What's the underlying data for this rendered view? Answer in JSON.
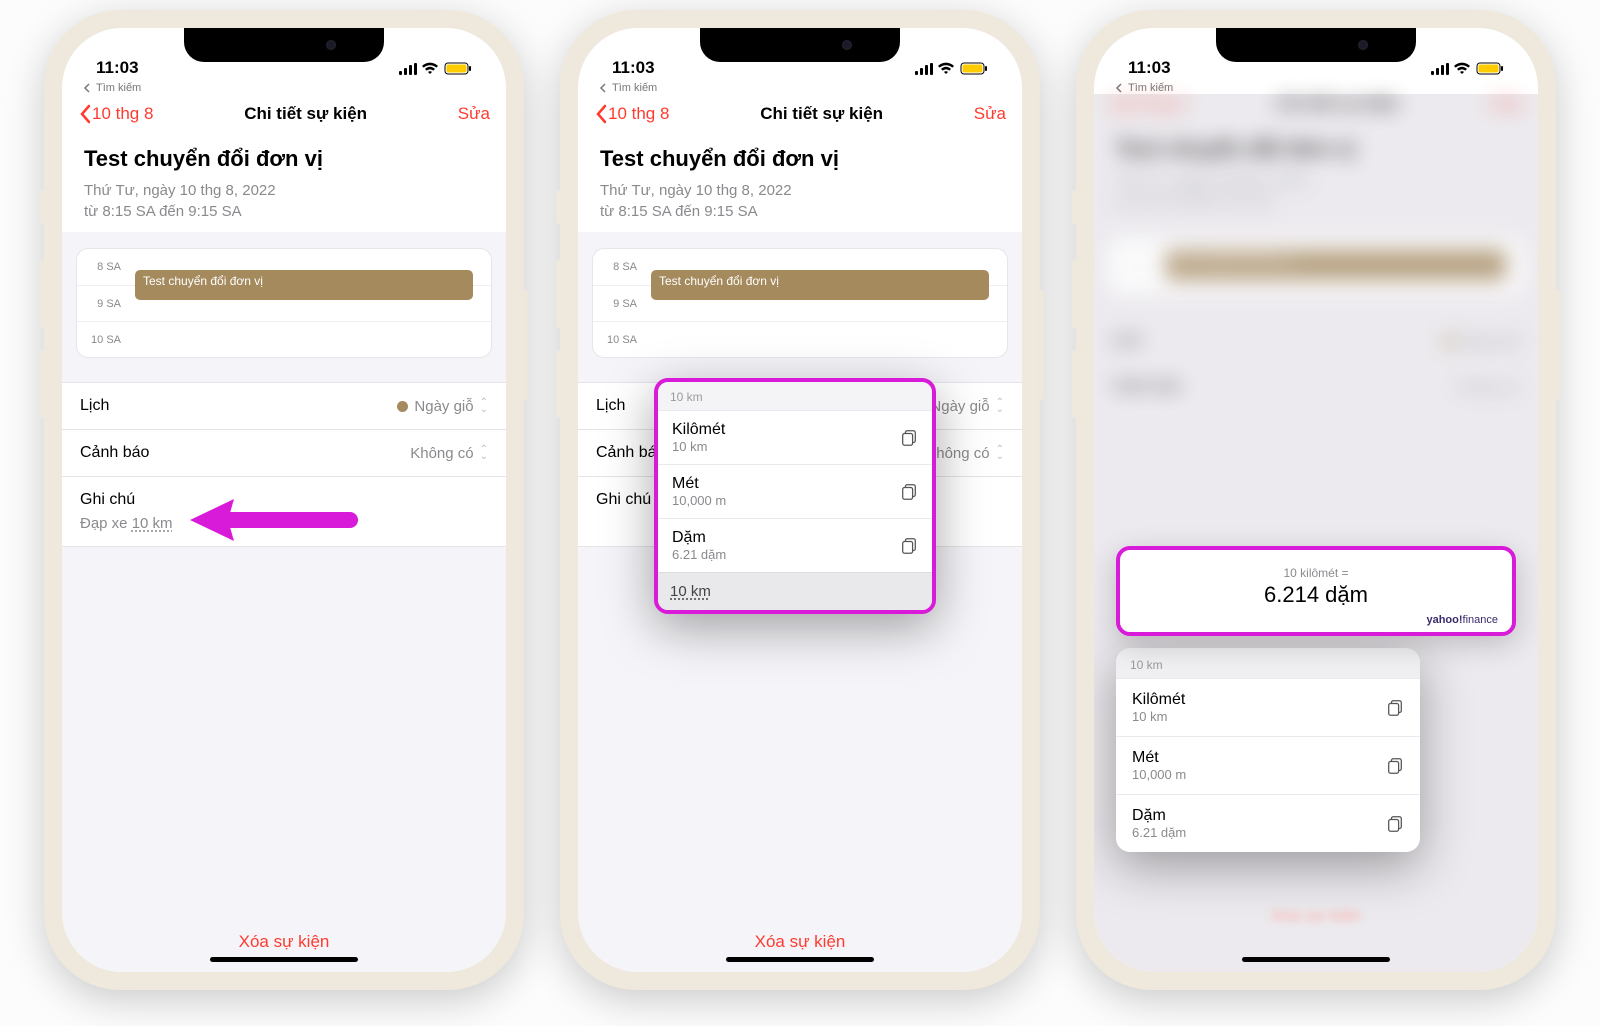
{
  "status": {
    "time": "11:03",
    "search_hint": "Tìm kiếm"
  },
  "nav": {
    "back": "10 thg 8",
    "title": "Chi tiết sự kiện",
    "edit": "Sửa"
  },
  "event": {
    "title": "Test chuyển đổi đơn vị",
    "date": "Thứ Tư, ngày 10 thg 8, 2022",
    "time_range": "từ 8:15 SA đến 9:15 SA",
    "tl_labels": [
      "8 SA",
      "9 SA",
      "10 SA"
    ],
    "tl_block": "Test chuyển đổi đơn vị"
  },
  "rows": {
    "cal_label": "Lịch",
    "cal_value": "Ngày giỗ",
    "alert_label": "Cảnh báo",
    "alert_value": "Không có",
    "note_label": "Ghi chú",
    "note_prefix": "Đạp xe ",
    "note_value_ul": "10 km"
  },
  "delete_label": "Xóa sự kiện",
  "popup": {
    "header": "10 km",
    "items": [
      {
        "name": "Kilômét",
        "val": "10 km"
      },
      {
        "name": "Mét",
        "val": "10,000 m"
      },
      {
        "name": "Dặm",
        "val": "6.21 dặm"
      }
    ],
    "tail_ul": "10 km"
  },
  "result": {
    "top": "10 kilômét =",
    "val": "6.214 dặm",
    "source1": "yahoo!",
    "source2": "finance"
  }
}
